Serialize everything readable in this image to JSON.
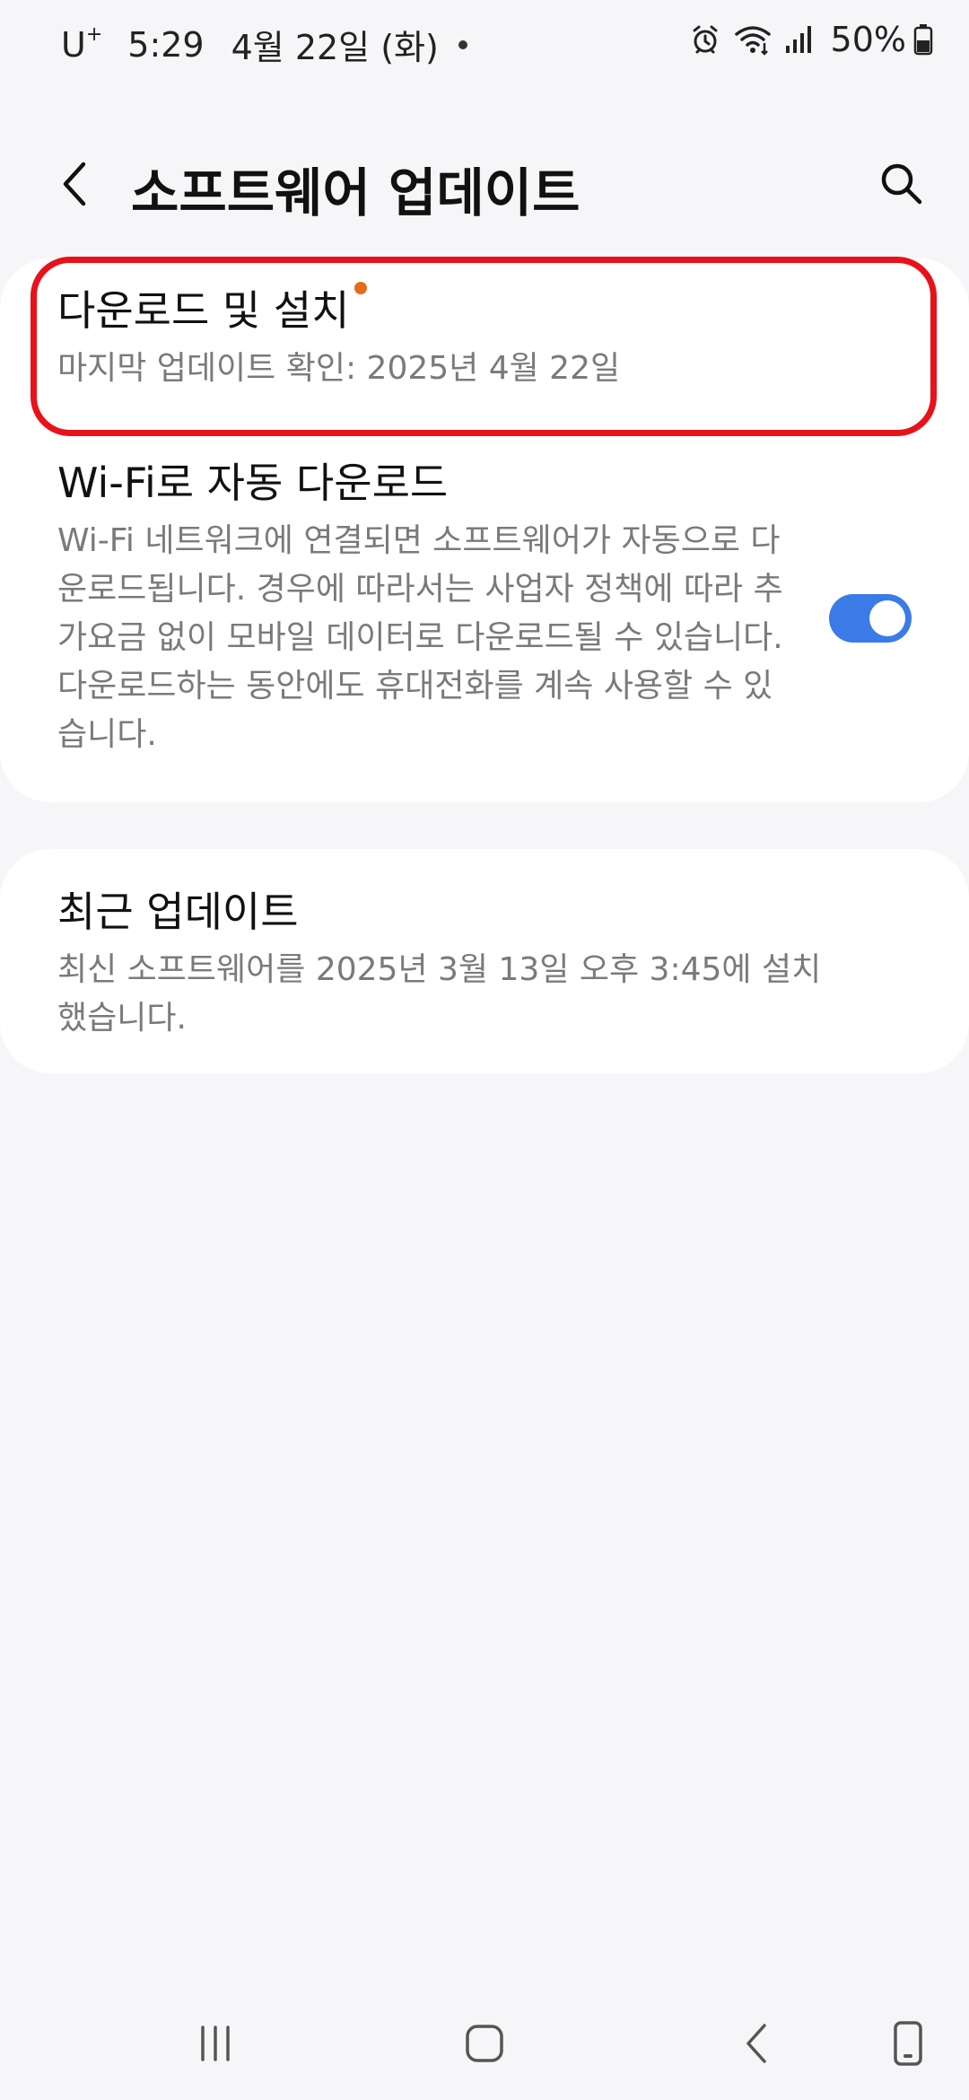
{
  "status_bar": {
    "carrier": "U",
    "carrier_sup": "+",
    "time": "5:29",
    "date": "4월 22일 (화)",
    "battery": "50%",
    "icons": [
      "alarm-icon",
      "wifi-icon",
      "signal-icon",
      "battery-icon"
    ]
  },
  "app_bar": {
    "title": "소프트웨어 업데이트",
    "back_icon": "chevron-left-icon",
    "search_icon": "search-icon"
  },
  "settings": {
    "download": {
      "title": "다운로드 및 설치",
      "subtitle": "마지막 업데이트 확인: 2025년 4월 22일"
    },
    "wifi_auto": {
      "title": "Wi-Fi로 자동 다운로드",
      "subtitle": "Wi-Fi 네트워크에 연결되면 소프트웨어가 자동으로 다운로드됩니다. 경우에 따라서는 사업자 정책에 따라 추가요금 없이 모바일 데이터로 다운로드될 수 있습니다. 다운로드하는 동안에도 휴대전화를 계속 사용할 수 있습니다.",
      "enabled": true
    },
    "recent": {
      "title": "최근 업데이트",
      "subtitle": "최신 소프트웨어를 2025년 3월 13일 오후 3:45에 설치했습니다."
    }
  },
  "colors": {
    "background": "#f6f6f8",
    "card": "#ffffff",
    "accent": "#3b7be8",
    "highlight": "#e8121a",
    "badge": "#e56a1a",
    "subtext": "#7a7a7a"
  },
  "nav_bar": {
    "icons": [
      "recent-apps-icon",
      "home-icon",
      "back-icon",
      "phone-icon"
    ]
  }
}
